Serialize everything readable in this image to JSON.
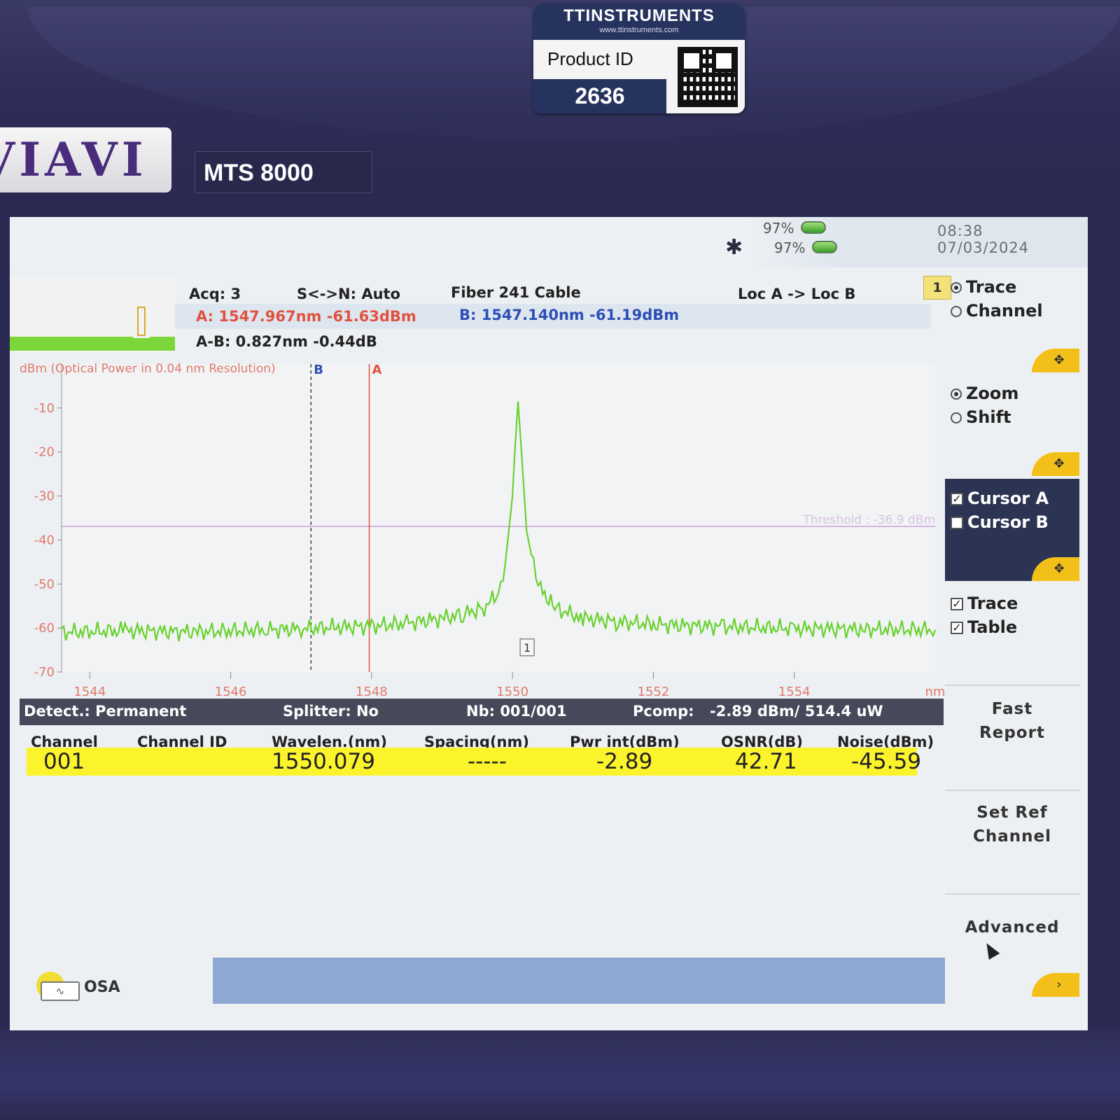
{
  "device": {
    "sticker_brand": "TTINSTRUMENTS",
    "sticker_url": "www.ttinstruments.com",
    "sticker_label": "Product ID",
    "product_id": "2636",
    "brand": "VIAVI",
    "model": "MTS 8000"
  },
  "status": {
    "battery1_pct": "97%",
    "battery2_pct": "97%",
    "time": "08:38",
    "date": "07/03/2024"
  },
  "info": {
    "acq": "Acq: 3",
    "sn": "S<->N: Auto",
    "fiber": "Fiber  241  Cable",
    "loc": "Loc A -> Loc B",
    "cursor_a": "A: 1547.967nm -61.63dBm",
    "cursor_b": "B: 1547.140nm -61.19dBm",
    "delta": "A-B: 0.827nm -0.44dB",
    "side_number": "1"
  },
  "chart_data": {
    "type": "line",
    "ylabel": "dBm (Optical Power in 0.04 nm Resolution)",
    "xlabel": "nm",
    "xlim": [
      1543.6,
      1556.0
    ],
    "ylim": [
      -70,
      0
    ],
    "x_ticks": [
      "1544",
      "1546",
      "1548",
      "1550",
      "1552",
      "1554",
      "nm"
    ],
    "y_ticks": [
      "-10",
      "-20",
      "-30",
      "-40",
      "-50",
      "-60",
      "-70"
    ],
    "threshold": {
      "label": "Threshold : -36.9 dBm",
      "value": -36.9
    },
    "cursor_a": {
      "label": "A",
      "x": 1547.967
    },
    "cursor_b": {
      "label": "B",
      "x": 1547.14
    },
    "peak_marker": "1",
    "series": [
      {
        "x": [
          1543.6,
          1544.5,
          1545.5,
          1546.5,
          1547.0,
          1547.5,
          1548.0,
          1548.5,
          1549.0,
          1549.3,
          1549.6,
          1549.8,
          1549.9,
          1550.0,
          1550.04,
          1550.079,
          1550.12,
          1550.2,
          1550.3,
          1550.4,
          1550.6,
          1551.0,
          1551.5,
          1552.0,
          1553.0,
          1554.0,
          1555.0,
          1556.0
        ],
        "values": [
          -61.0,
          -60.6,
          -60.9,
          -60.4,
          -60.2,
          -59.8,
          -59.6,
          -58.9,
          -57.8,
          -56.9,
          -55.4,
          -52.0,
          -45.0,
          -30.0,
          -18.0,
          -8.5,
          -18.0,
          -38.0,
          -46.0,
          -51.0,
          -55.5,
          -57.8,
          -58.6,
          -59.2,
          -59.7,
          -60.1,
          -60.3,
          -60.4
        ]
      }
    ]
  },
  "table": {
    "detect": "Detect.: Permanent",
    "splitter": "Splitter: No",
    "nb": "Nb: 001/001",
    "pcomp_label": "Pcomp:",
    "pcomp_value": "-2.89 dBm/ 514.4 uW",
    "columns": [
      "Channel",
      "Channel ID",
      "Wavelen.(nm)",
      "Spacing(nm)",
      "Pwr int(dBm)",
      "OSNR(dB)",
      "Noise(dBm)"
    ],
    "rows": [
      {
        "channel": "001",
        "channel_id": "",
        "wavelength": "1550.079",
        "spacing": "-----",
        "pwr": "-2.89",
        "osnr": "42.71",
        "noise": "-45.59"
      }
    ]
  },
  "menu": {
    "trace": "Trace",
    "channel": "Channel",
    "zoom": "Zoom",
    "shift": "Shift",
    "cursor_a": "Cursor A",
    "cursor_b": "Cursor B",
    "trace_check": "Trace",
    "table_check": "Table",
    "fast_report_1": "Fast",
    "fast_report_2": "Report",
    "set_ref_1": "Set Ref",
    "set_ref_2": "Channel",
    "advanced": "Advanced"
  },
  "bottom": {
    "osa_label": "OSA"
  }
}
